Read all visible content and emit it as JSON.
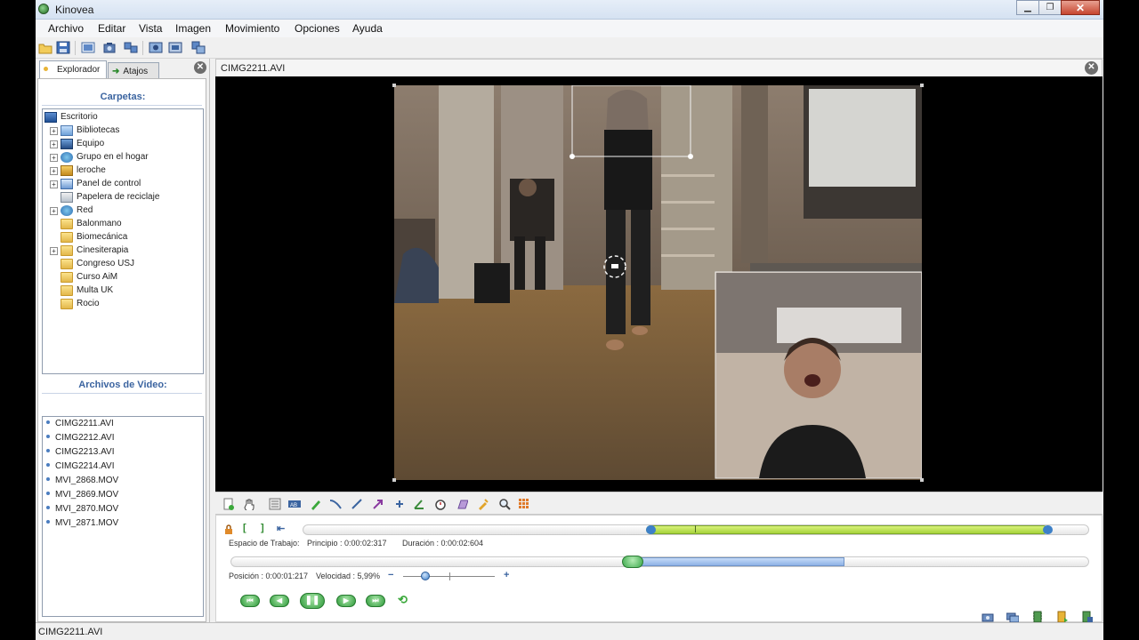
{
  "window": {
    "title": "Kinovea"
  },
  "menu": [
    "Archivo",
    "Editar",
    "Vista",
    "Imagen",
    "Movimiento",
    "Opciones",
    "Ayuda"
  ],
  "tabs": {
    "explorer": "Explorador",
    "shortcuts": "Atajos"
  },
  "folders_section": {
    "title": "Carpetas:"
  },
  "tree": [
    {
      "label": "Escritorio",
      "icon": "desktop-icon",
      "level": 0,
      "expander": false
    },
    {
      "label": "Bibliotecas",
      "icon": "library-icon",
      "level": 1,
      "expander": true
    },
    {
      "label": "Equipo",
      "icon": "computer-icon",
      "level": 1,
      "expander": true
    },
    {
      "label": "Grupo en el hogar",
      "icon": "homegroup-icon",
      "level": 1,
      "expander": true
    },
    {
      "label": "leroche",
      "icon": "user-folder-icon",
      "level": 1,
      "expander": true
    },
    {
      "label": "Panel de control",
      "icon": "control-panel-icon",
      "level": 1,
      "expander": true
    },
    {
      "label": "Papelera de reciclaje",
      "icon": "recycle-bin-icon",
      "level": 1,
      "expander": false
    },
    {
      "label": "Red",
      "icon": "network-icon",
      "level": 1,
      "expander": true
    },
    {
      "label": "Balonmano",
      "icon": "folder-icon",
      "level": 1,
      "expander": false
    },
    {
      "label": "Biomecánica",
      "icon": "folder-icon",
      "level": 1,
      "expander": false
    },
    {
      "label": "Cinesiterapia",
      "icon": "folder-icon",
      "level": 1,
      "expander": true
    },
    {
      "label": "Congreso USJ",
      "icon": "folder-icon",
      "level": 1,
      "expander": false
    },
    {
      "label": "Curso AiM",
      "icon": "folder-icon",
      "level": 1,
      "expander": false
    },
    {
      "label": "Multa UK",
      "icon": "folder-icon",
      "level": 1,
      "expander": false
    },
    {
      "label": "Rocio",
      "icon": "folder-icon",
      "level": 1,
      "expander": false
    }
  ],
  "videos_section": {
    "title": "Archivos de Video:"
  },
  "videos": [
    "CIMG2211.AVI",
    "CIMG2212.AVI",
    "CIMG2213.AVI",
    "CIMG2214.AVI",
    "MVI_2868.MOV",
    "MVI_2869.MOV",
    "MVI_2870.MOV",
    "MVI_2871.MOV"
  ],
  "player": {
    "filename": "CIMG2211.AVI",
    "workspace_label": "Espacio de Trabajo:",
    "start_label": "Principio : 0:00:02:317",
    "duration_label": "Duración : 0:00:02:604",
    "position_label": "Posición : 0:00:01:217",
    "speed_label": "Velocidad : 5,99%",
    "speed_minus": "−",
    "speed_plus": "+"
  },
  "status": {
    "text": "CIMG2211.AVI"
  },
  "colors": {
    "accent": "#3b64a0",
    "selection_green": "#b7e04a",
    "playhead_blue": "#9ec0ee"
  }
}
